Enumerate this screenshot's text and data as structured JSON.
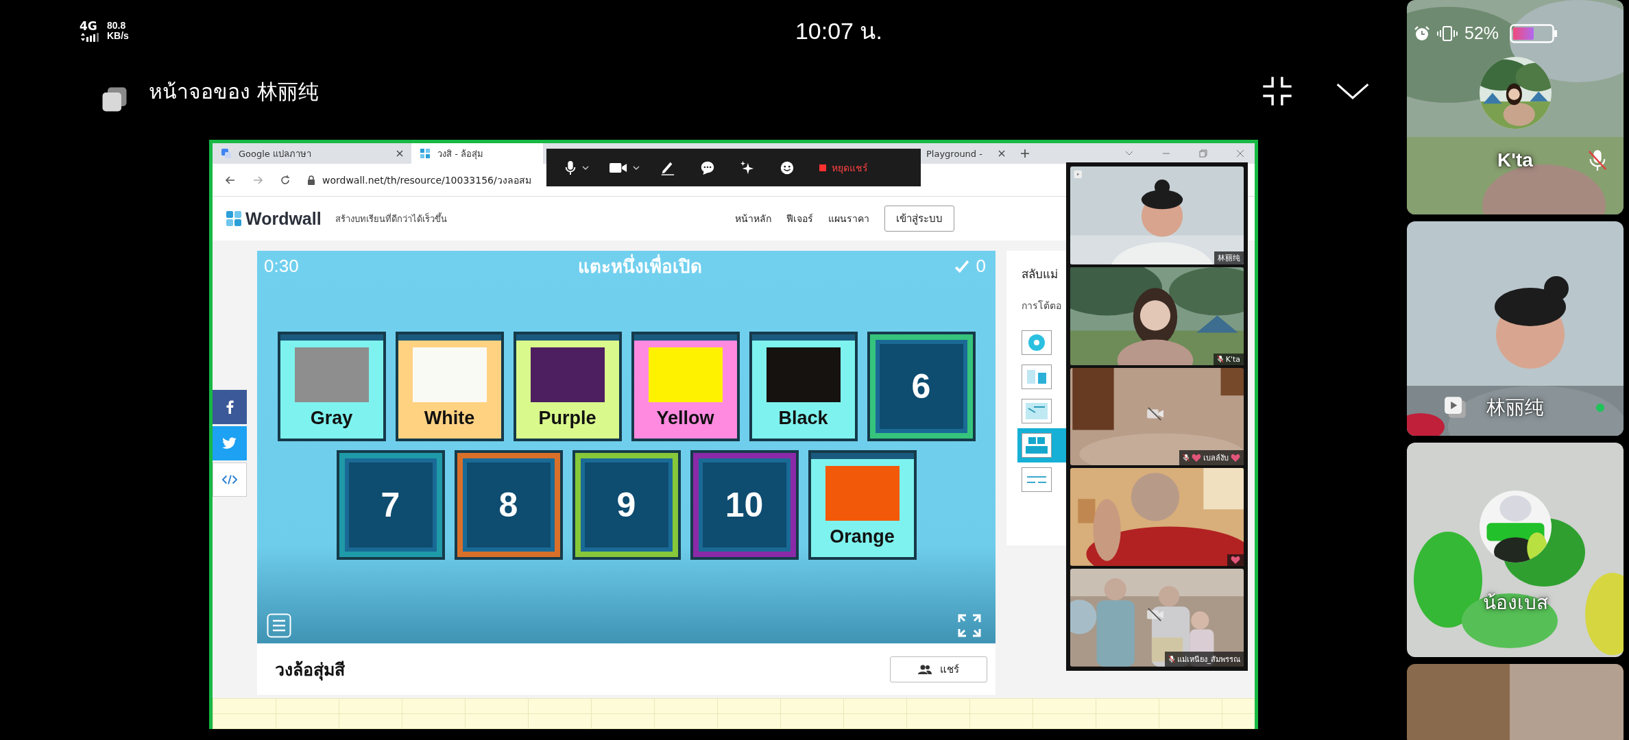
{
  "status_bar": {
    "network": "4G",
    "speed": "80.8",
    "speed_unit": "KB/s",
    "time": "10:07 น.",
    "battery": "52%"
  },
  "share_header": {
    "title": "หน้าจอของ 林丽纯"
  },
  "browser": {
    "tabs": [
      {
        "label": "Google แปลภาษา",
        "selected": false,
        "kind": "translate"
      },
      {
        "label": "วงสิ - ล้อสุ่ม",
        "selected": true,
        "kind": "wordwall"
      },
      {
        "label": "Playground -",
        "selected": false,
        "kind": "plain"
      }
    ],
    "url": "wordwall.net/th/resource/10033156/วงลอสม"
  },
  "meeting_toolbar": {
    "stop_label": "หยุดแชร์"
  },
  "site": {
    "logo": "Wordwall",
    "tagline": "สร้างบทเรียนที่ดีกว่าได้เร็วขึ้น",
    "nav": [
      "หน้าหลัก",
      "ฟีเจอร์",
      "แผนราคา"
    ],
    "login": "เข้าสู่ระบบ"
  },
  "social": [
    {
      "kind": "facebook"
    },
    {
      "kind": "twitter"
    },
    {
      "kind": "embed"
    }
  ],
  "game": {
    "timer": "0:30",
    "prompt": "แตะหนึ่งเพื่อเปิด",
    "score": "0",
    "rows": [
      [
        {
          "kind": "revealed",
          "label": "Gray",
          "swatch": {
            "color": "#8e8e8e"
          },
          "frame": {
            "color": "#7ef2ee"
          }
        },
        {
          "kind": "revealed",
          "label": "White",
          "swatch": {
            "color": "#fafaf5"
          },
          "frame": {
            "color": "#ffd282"
          }
        },
        {
          "kind": "revealed",
          "label": "Purple",
          "swatch": {
            "color": "#4e1f60"
          },
          "frame": {
            "color": "#d9f98c"
          }
        },
        {
          "kind": "revealed",
          "label": "Yellow",
          "swatch": {
            "color": "#fff200"
          },
          "frame": {
            "color": "#ff8ae0"
          }
        },
        {
          "kind": "revealed",
          "label": "Black",
          "swatch": {
            "color": "#151210"
          },
          "frame": {
            "color": "#7ef2ee"
          }
        },
        {
          "kind": "hidden",
          "label": "6",
          "frame": {
            "color": "#36c47c"
          }
        }
      ],
      [
        {
          "kind": "hidden",
          "label": "7",
          "frame": {
            "color": "#1f9aa8"
          }
        },
        {
          "kind": "hidden",
          "label": "8",
          "frame": {
            "color": "#d8702a"
          }
        },
        {
          "kind": "hidden",
          "label": "9",
          "frame": {
            "color": "#86c83a"
          }
        },
        {
          "kind": "hidden",
          "label": "10",
          "frame": {
            "color": "#8a2aa8"
          }
        },
        {
          "kind": "revealed",
          "label": "Orange",
          "swatch": {
            "color": "#f25a0a"
          },
          "frame": {
            "color": "#7ef2ee"
          }
        }
      ]
    ]
  },
  "side_panel": {
    "title": "สลับแม่",
    "subtitle": "การโต้ตอ",
    "templates": [
      {
        "kind": "wheel",
        "selected": false
      },
      {
        "kind": "cards",
        "selected": false
      },
      {
        "kind": "quiz",
        "selected": false
      },
      {
        "kind": "boxes",
        "selected": true
      },
      {
        "kind": "text",
        "selected": false
      }
    ]
  },
  "activity": {
    "title": "วงล้อสุ่มสี",
    "share": "แชร์"
  },
  "video_strip": [
    {
      "name": "林丽纯",
      "muted": false,
      "camera_off": false,
      "hearts": false
    },
    {
      "name": "K'ta",
      "muted": true,
      "camera_off": false,
      "hearts": false
    },
    {
      "name": "เบลล์งับ",
      "muted": true,
      "camera_off": true,
      "hearts": true
    },
    {
      "muted": false,
      "camera_off": false,
      "hearts": true
    },
    {
      "name": "แม่เหนียง_สัมพรรณ",
      "muted": true,
      "camera_off": true,
      "hearts": false
    }
  ],
  "participants": [
    {
      "kind": "avatar",
      "name": "K'ta",
      "muted": true,
      "speaking": false
    },
    {
      "kind": "video",
      "name": "林丽纯",
      "muted": false,
      "speaking": true
    },
    {
      "kind": "avatar",
      "name": "น้องเบส",
      "muted": false,
      "speaking": false
    },
    {
      "kind": "video"
    }
  ]
}
